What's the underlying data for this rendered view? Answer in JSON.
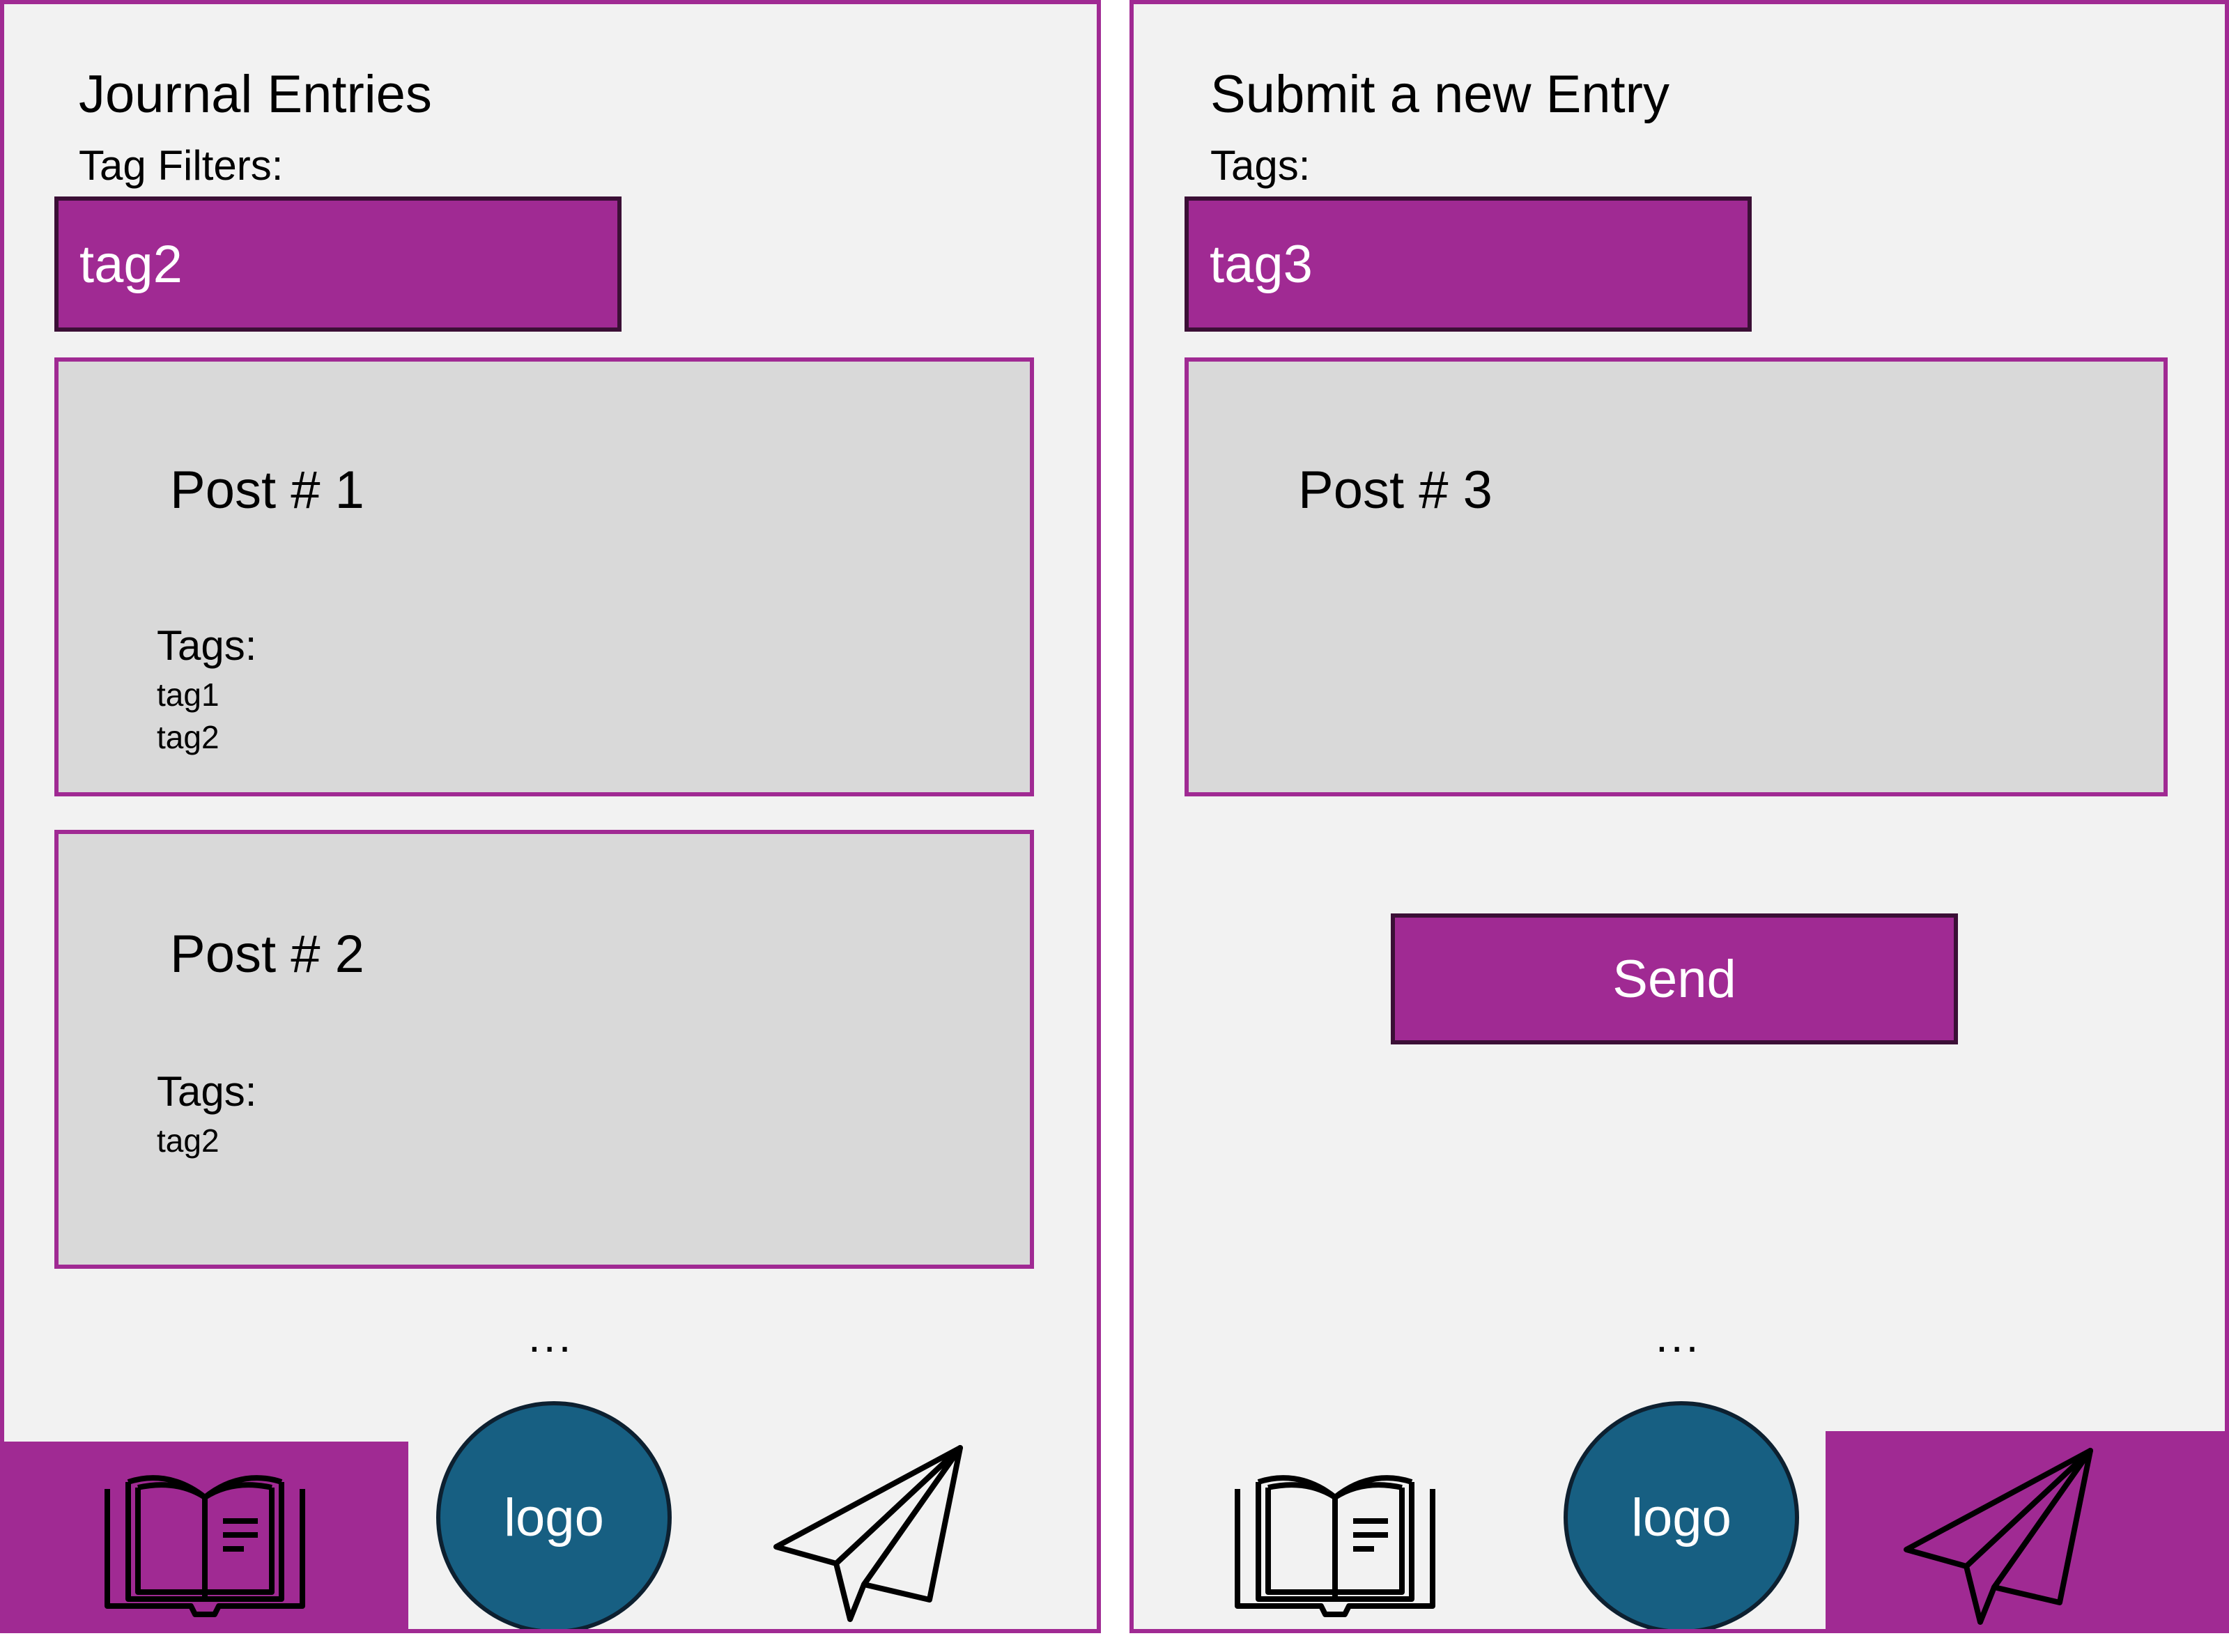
{
  "colors": {
    "accent": "#a02a93",
    "accent_border": "#3b0f36",
    "logo_fill": "#175f82",
    "screen_bg": "#f2f2f2",
    "card_bg": "#d9d9d9"
  },
  "journal_screen": {
    "title": "Journal Entries",
    "filter_label": "Tag Filters:",
    "filter_value": "tag2",
    "posts": [
      {
        "title": "Post # 1",
        "tags_label": "Tags:",
        "tags": [
          "tag1",
          "tag2"
        ]
      },
      {
        "title": "Post # 2",
        "tags_label": "Tags:",
        "tags": [
          "tag2"
        ]
      }
    ],
    "more_indicator": "...",
    "nav": {
      "active_item": "journal",
      "items": [
        {
          "id": "journal",
          "icon": "open-book-icon"
        },
        {
          "id": "home",
          "icon": "logo",
          "label": "logo"
        },
        {
          "id": "submit",
          "icon": "paper-plane-icon"
        }
      ]
    }
  },
  "submit_screen": {
    "title": "Submit a new Entry",
    "tags_label": "Tags:",
    "tags_value": "tag3",
    "draft_post_title": "Post # 3",
    "send_label": "Send",
    "more_indicator": "...",
    "nav": {
      "active_item": "submit",
      "items": [
        {
          "id": "journal",
          "icon": "open-book-icon"
        },
        {
          "id": "home",
          "icon": "logo",
          "label": "logo"
        },
        {
          "id": "submit",
          "icon": "paper-plane-icon"
        }
      ]
    }
  }
}
